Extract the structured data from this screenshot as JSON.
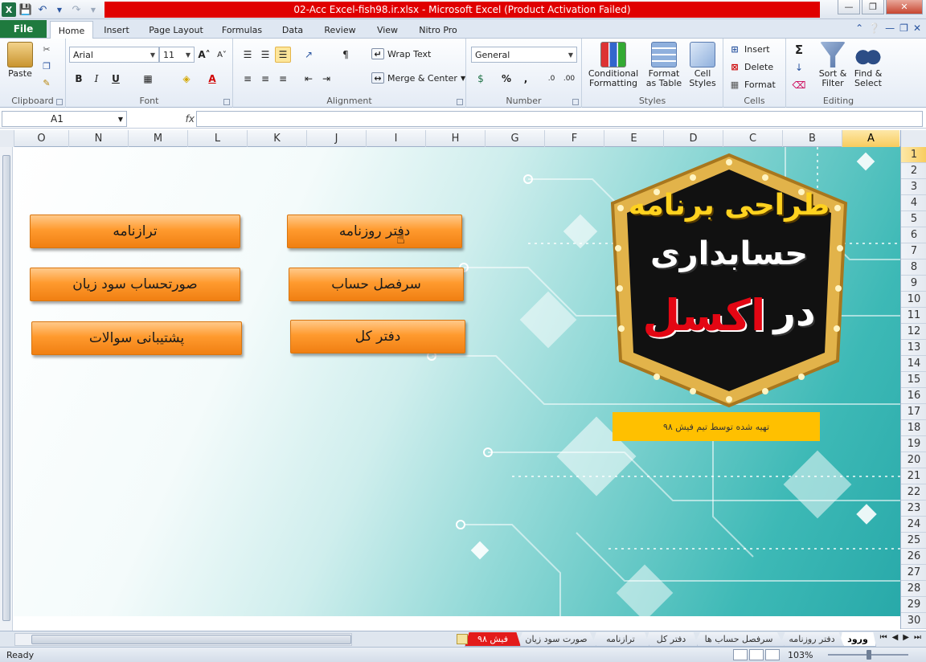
{
  "window": {
    "title": "02-Acc Excel-fish98.ir.xlsx  -  Microsoft Excel (Product Activation Failed)"
  },
  "tabs": {
    "file": "File",
    "items": [
      "Home",
      "Insert",
      "Page Layout",
      "Formulas",
      "Data",
      "Review",
      "View",
      "Nitro Pro"
    ]
  },
  "ribbon": {
    "clipboard": {
      "label": "Clipboard",
      "paste": "Paste"
    },
    "font": {
      "label": "Font",
      "name": "Arial",
      "size": "11",
      "bold": "B",
      "italic": "I",
      "underline": "U"
    },
    "alignment": {
      "label": "Alignment",
      "wrap_text": "Wrap Text",
      "merge_center": "Merge & Center"
    },
    "number": {
      "label": "Number",
      "format": "General",
      "percent": "%",
      "comma": ","
    },
    "styles": {
      "label": "Styles",
      "conditional_1": "Conditional",
      "conditional_2": "Formatting",
      "format_table_1": "Format",
      "format_table_2": "as Table",
      "cell_styles_1": "Cell",
      "cell_styles_2": "Styles"
    },
    "cells": {
      "label": "Cells",
      "insert": "Insert",
      "delete": "Delete",
      "format": "Format"
    },
    "editing": {
      "label": "Editing",
      "sort_1": "Sort &",
      "sort_2": "Filter",
      "find_1": "Find &",
      "find_2": "Select"
    }
  },
  "formula_bar": {
    "name_box": "A1",
    "fx": "fx",
    "value": ""
  },
  "columns": [
    "O",
    "N",
    "M",
    "L",
    "K",
    "J",
    "I",
    "H",
    "G",
    "F",
    "E",
    "D",
    "C",
    "B",
    "A"
  ],
  "selected_column": "A",
  "rows": [
    "1",
    "2",
    "3",
    "4",
    "5",
    "6",
    "7",
    "8",
    "9",
    "10",
    "11",
    "12",
    "13",
    "14",
    "15",
    "16",
    "17",
    "18",
    "19",
    "20",
    "21",
    "22",
    "23",
    "24",
    "25",
    "26",
    "27",
    "28",
    "29",
    "30"
  ],
  "selected_row": "1",
  "sheet_content": {
    "buttons": {
      "balance_sheet": "ترازنامه",
      "journal": "دفتر روزنامه",
      "income_statement": "صورتحساب سود زیان",
      "account_headings": "سرفصل حساب",
      "faq_support": "پشتیبانی سوالات",
      "ledger": "دفتر کل"
    },
    "logo": {
      "line1": "طراحی برنامه",
      "line2": "حسابداری",
      "line3_a": "در",
      "line3_b": "اکسل"
    },
    "credit": "تهیه شده توسط تیم فیش ۹۸"
  },
  "sheet_tabs": [
    {
      "name": "ورود",
      "active": true
    },
    {
      "name": "دفتر روزنامه",
      "active": false
    },
    {
      "name": "سرفصل حساب ها",
      "active": false
    },
    {
      "name": "دفتر کل",
      "active": false
    },
    {
      "name": "ترازنامه",
      "active": false
    },
    {
      "name": "صورت سود زیان",
      "active": false
    },
    {
      "name": "فیش ۹۸",
      "active": false,
      "red": true
    }
  ],
  "status": {
    "ready": "Ready",
    "zoom": "103%"
  },
  "colors": {
    "accent_red": "#e00000",
    "button_orange": "#ff9a2e",
    "teal": "#28a9a9",
    "credit_yellow": "#ffc000",
    "file_green": "#1f7a3e"
  }
}
